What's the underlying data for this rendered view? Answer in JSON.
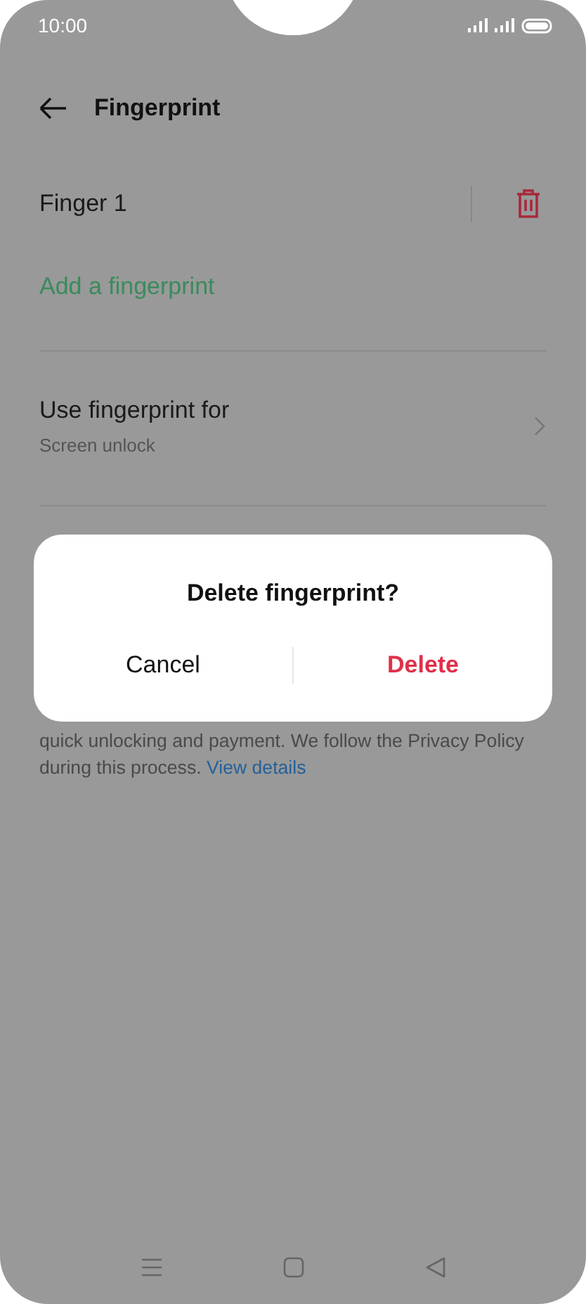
{
  "status_bar": {
    "time": "10:00"
  },
  "header": {
    "title": "Fingerprint"
  },
  "fingerprints": [
    {
      "name": "Finger 1"
    }
  ],
  "add_link": "Add a fingerprint",
  "settings": [
    {
      "title": "Use fingerprint for",
      "subtitle": "Screen unlock"
    }
  ],
  "notice": {
    "lines": [
      "quick unlocking and payment. We follow the Privacy Policy",
      "during this process."
    ],
    "link": "View details"
  },
  "dialog": {
    "title": "Delete fingerprint?",
    "buttons": [
      {
        "label": "Cancel",
        "kind": "normal"
      },
      {
        "label": "Delete",
        "kind": "destructive"
      }
    ]
  }
}
